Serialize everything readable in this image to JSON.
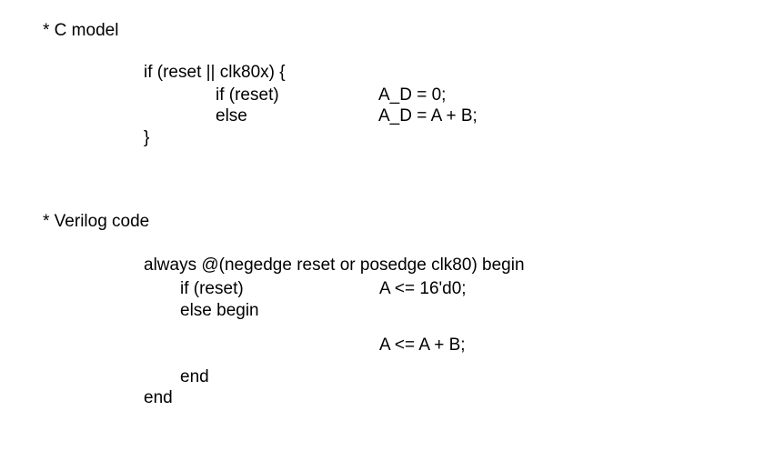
{
  "c_model": {
    "label": "* C model",
    "line1": "if (reset || clk80x) {",
    "line2_left": "if (reset)",
    "line2_right": "A_D = 0;",
    "line3_left": "else",
    "line3_right": "A_D = A + B;",
    "line4": "}"
  },
  "verilog": {
    "label": "* Verilog code",
    "line1": "always @(negedge reset or posedge clk80) begin",
    "line2_left": "if (reset)",
    "line2_right": "A <= 16'd0;",
    "line3": "else begin",
    "line4": "A <= A + B;",
    "line5": "end",
    "line6": "end"
  }
}
